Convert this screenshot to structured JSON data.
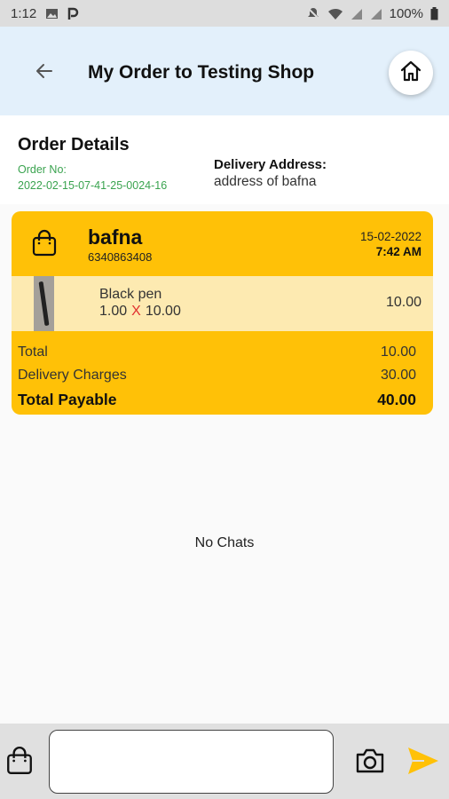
{
  "status_bar": {
    "time": "1:12",
    "battery": "100%",
    "icons": [
      "image-icon",
      "p-icon",
      "mute-icon",
      "wifi-icon",
      "signal-icon",
      "signal-icon",
      "battery-icon"
    ]
  },
  "app_bar": {
    "title": "My Order to Testing Shop",
    "back_icon": "arrow-left-icon",
    "home_icon": "home-icon"
  },
  "order": {
    "heading": "Order Details",
    "order_no_label": "Order No:",
    "order_no": "2022-02-15-07-41-25-0024-16",
    "delivery_label": "Delivery Address:",
    "delivery_address": "address of bafna",
    "customer_name": "bafna",
    "customer_phone": "6340863408",
    "date": "15-02-2022",
    "time": "7:42 AM",
    "items": [
      {
        "name": "Black pen",
        "qty": "1.00",
        "times": "X",
        "price": "10.00",
        "amount": "10.00"
      }
    ],
    "totals": [
      {
        "label": "Total",
        "value": "10.00"
      },
      {
        "label": "Delivery Charges",
        "value": "30.00"
      },
      {
        "label": "Total Payable",
        "value": "40.00"
      }
    ]
  },
  "chat": {
    "empty_text": "No Chats",
    "input_value": ""
  },
  "colors": {
    "accent": "#ffc107",
    "item_row": "#fdeab1",
    "app_bar": "#e3f0fb",
    "order_no": "#3aa34f",
    "send": "#ffc107"
  }
}
